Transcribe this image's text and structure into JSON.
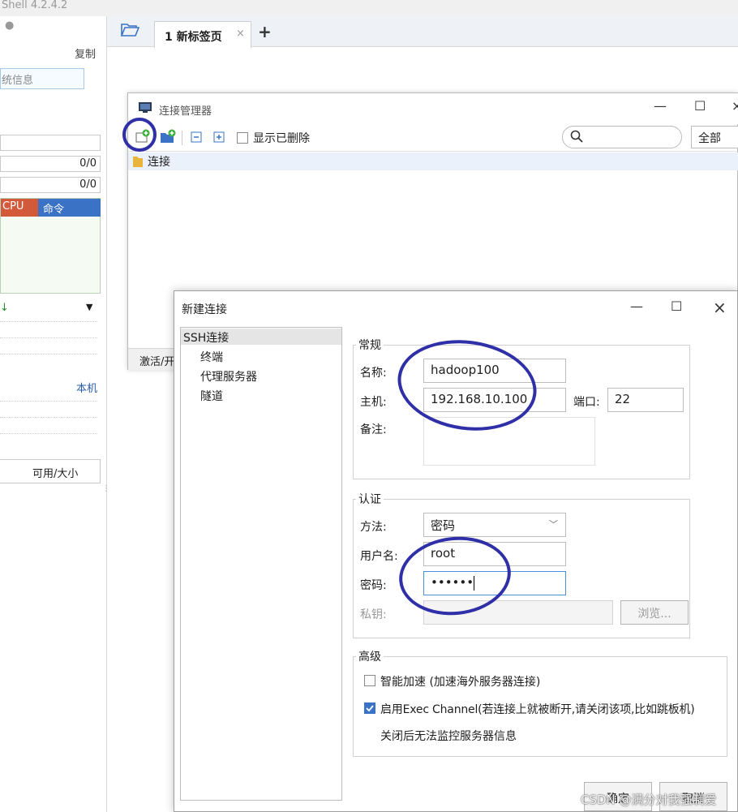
{
  "app": {
    "title": "Shell 4.2.4.2"
  },
  "left_panel": {
    "copy_label": "复制",
    "sysinfo_label": "统信息",
    "counter1": "0/0",
    "counter2": "0/0",
    "col_cpu": "CPU",
    "col_cmd": "命令",
    "local_label": "本机",
    "avail_size_label": "可用/大小"
  },
  "tabs": [
    {
      "label": "1 新标签页"
    }
  ],
  "conn_manager": {
    "title": "连接管理器",
    "show_deleted": "显示已删除",
    "filter": "全部",
    "tree_root": "连接",
    "status": "激活/开"
  },
  "new_connection": {
    "title": "新建连接",
    "nav": [
      "SSH连接",
      "终端",
      "代理服务器",
      "隧道"
    ],
    "general": {
      "legend": "常规",
      "name_label": "名称:",
      "name_value": "hadoop100",
      "host_label": "主机:",
      "host_value": "192.168.10.100",
      "port_label": "端口:",
      "port_value": "22",
      "note_label": "备注:"
    },
    "auth": {
      "legend": "认证",
      "method_label": "方法:",
      "method_value": "密码",
      "user_label": "用户名:",
      "user_value": "root",
      "pass_label": "密码:",
      "pass_value": "••••••",
      "key_label": "私钥:",
      "browse": "浏览..."
    },
    "advanced": {
      "legend": "高级",
      "smart_accel": "智能加速 (加速海外服务器连接)",
      "exec_channel": "启用Exec Channel(若连接上就被断开,请关闭该项,比如跳板机)",
      "exec_note": "关闭后无法监控服务器信息",
      "smart_accel_checked": false,
      "exec_channel_checked": true
    },
    "ok": "确定",
    "cancel": "取消"
  },
  "watermark": "CSDN @满分对我强制爱",
  "colors": {
    "annotation": "#2f2fa8",
    "cpu_header": "#d25a3b",
    "cmd_header": "#3a73c6"
  }
}
